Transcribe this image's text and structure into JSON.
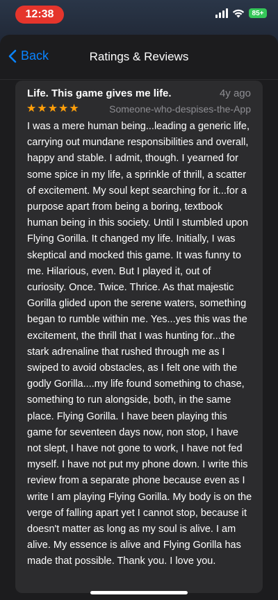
{
  "status": {
    "time": "12:38",
    "battery": "85+"
  },
  "nav": {
    "back_label": "Back",
    "title": "Ratings & Reviews"
  },
  "review": {
    "title": "Life. This game gives me life.",
    "age": "4y ago",
    "rating": 5,
    "stars": "★★★★★",
    "author": "Someone-who-despises-the-App",
    "body": "I was a mere human being...leading a generic life, carrying out mundane responsibilities and overall, happy and stable. I admit, though. I yearned for some spice in my life, a sprinkle of thrill, a scatter of excitement. My soul kept searching for it...for a purpose apart from being a boring, textbook human being in this society. Until I stumbled upon Flying Gorilla. It changed my life. Initially, I was skeptical and mocked this game. It was funny to me. Hilarious, even. But I played it, out of curiosity. Once. Twice. Thrice. As that majestic Gorilla glided upon the serene waters, something began to rumble within me. Yes...yes this was the excitement, the thrill that I was hunting for...the stark adrenaline that rushed through me as I swiped to avoid obstacles, as I felt one with the godly Gorilla....my life found something to chase, something to run alongside, both, in the same place. Flying Gorilla. I have been playing this game for seventeen days now, non stop, I have not slept, I have not gone to work, I have not fed myself. I have not put my phone down. I write this review from a separate phone because even as I write I am playing Flying Gorilla. My body is on the verge of falling apart yet I cannot stop, because it doesn't matter as long as my soul is alive. I am alive. My essence is alive and Flying Gorilla has made that possible. Thank you. I love you."
  },
  "colors": {
    "accent": "#0a84ff",
    "stars": "#ff9f0a",
    "time_pill": "#e5352c",
    "battery": "#35c759"
  },
  "icons": [
    "back-chevron-icon",
    "cellular-signal-icon",
    "wifi-icon",
    "battery-icon",
    "star-icon"
  ]
}
